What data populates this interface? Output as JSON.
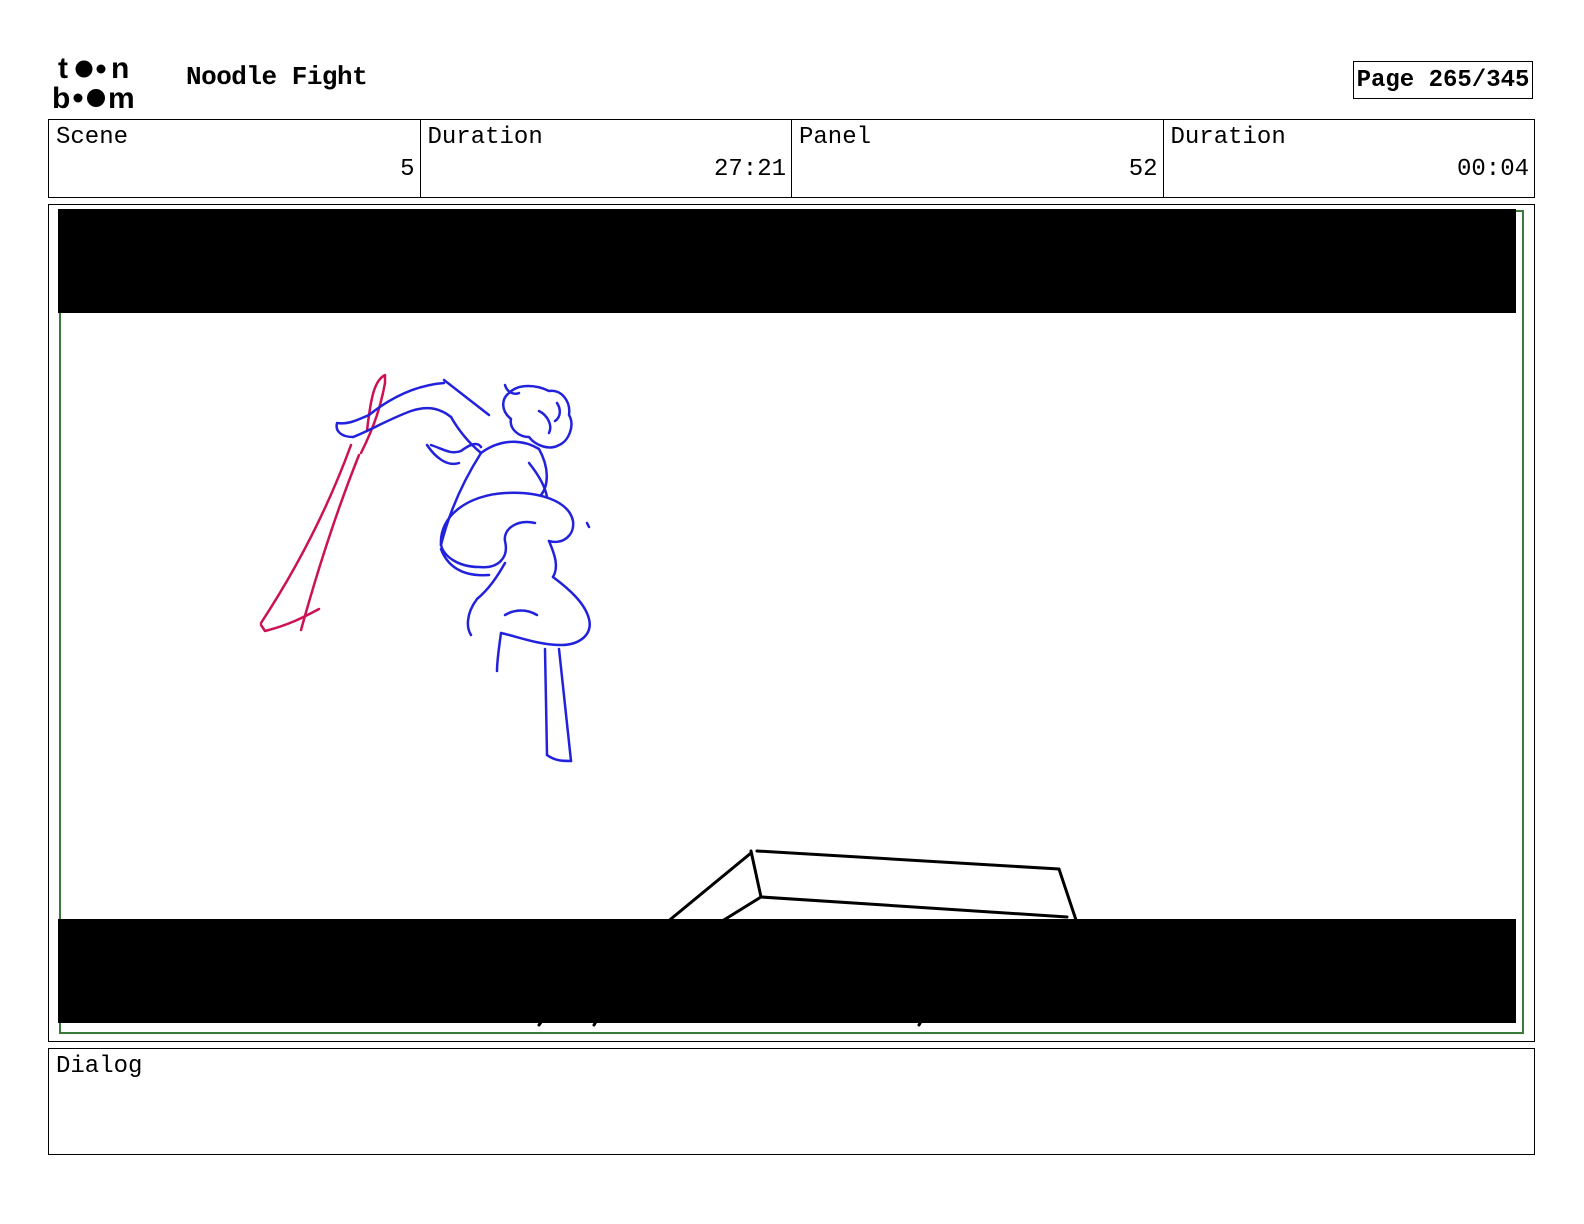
{
  "header": {
    "logo_text": "toon boom",
    "project_title": "Noodle Fight",
    "page_label": "Page 265/345"
  },
  "info": {
    "scene_label": "Scene",
    "scene_value": "5",
    "scene_duration_label": "Duration",
    "scene_duration_value": "27:21",
    "panel_label": "Panel",
    "panel_value": "52",
    "panel_duration_label": "Duration",
    "panel_duration_value": "00:04"
  },
  "dialog": {
    "label": "Dialog"
  },
  "colors": {
    "safe_area_border": "#3a7a3a",
    "character_sketch": "#2222dd",
    "weapon_sketch": "#cc1155",
    "letterbox": "#000000"
  }
}
